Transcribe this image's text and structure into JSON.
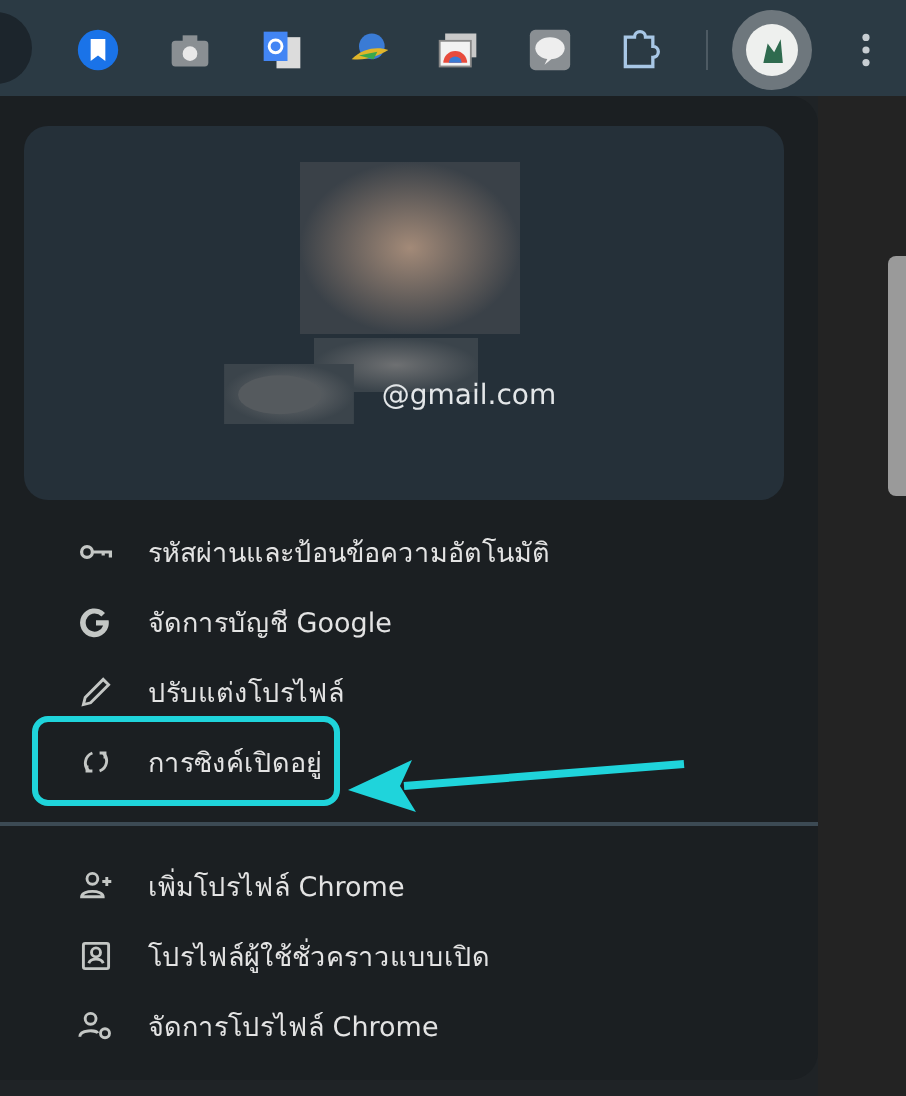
{
  "profile": {
    "email": "@gmail.com"
  },
  "sections": [
    {
      "items": [
        {
          "kind": "key",
          "label": "รหัสผ่านและป้อนข้อความอัตโนมัติ",
          "highlighted": false
        },
        {
          "kind": "google",
          "label": "จัดการบัญชี Google",
          "highlighted": false
        },
        {
          "kind": "pencil",
          "label": "ปรับแต่งโปรไฟล์",
          "highlighted": false
        },
        {
          "kind": "sync",
          "label": "การซิงค์เปิดอยู่",
          "highlighted": true
        }
      ]
    },
    {
      "items": [
        {
          "kind": "person-add",
          "label": "เพิ่มโปรไฟล์ Chrome",
          "highlighted": false
        },
        {
          "kind": "profile",
          "label": "โปรไฟล์ผู้ใช้ชั่วคราวแบบเปิด",
          "highlighted": false
        },
        {
          "kind": "person-gear",
          "label": "จัดการโปรไฟล์ Chrome",
          "highlighted": false
        }
      ]
    }
  ]
}
